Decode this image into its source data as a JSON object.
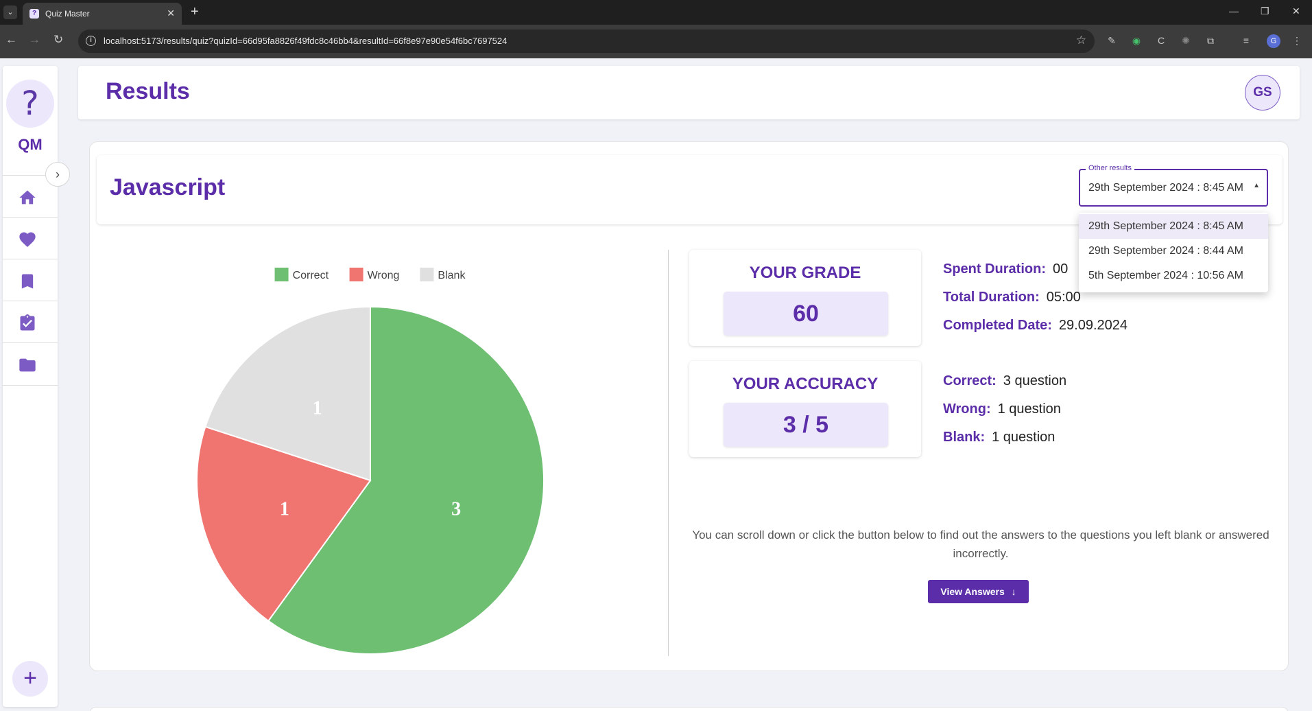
{
  "browser": {
    "tab_title": "Quiz Master",
    "url": "localhost:5173/results/quiz?quizId=66d95fa8826f49fdc8c46bb4&resultId=66f8e97e90e54f6bc7697524",
    "profile_initial": "G"
  },
  "sidebar": {
    "logo_text": "QM",
    "items": [
      {
        "icon": "home-icon"
      },
      {
        "icon": "heart-icon"
      },
      {
        "icon": "bookmark-icon"
      },
      {
        "icon": "clipboard-check-icon"
      },
      {
        "icon": "folder-icon"
      }
    ]
  },
  "header": {
    "title": "Results",
    "avatar_initials": "GS"
  },
  "quiz": {
    "title": "Javascript"
  },
  "other_results": {
    "label": "Other results",
    "selected": "29th September 2024 : 8:45 AM",
    "options": [
      "29th September 2024 : 8:45 AM",
      "29th September 2024 : 8:44 AM",
      "5th September 2024 : 10:56 AM"
    ]
  },
  "grade": {
    "title": "YOUR GRADE",
    "value": "60"
  },
  "accuracy": {
    "title": "YOUR ACCURACY",
    "value": "3 / 5"
  },
  "details": {
    "spent_label": "Spent Duration:",
    "spent_value": "00",
    "total_label": "Total Duration:",
    "total_value": "05:00",
    "completed_label": "Completed Date:",
    "completed_value": "29.09.2024",
    "correct_label": "Correct:",
    "correct_value": "3 question",
    "wrong_label": "Wrong:",
    "wrong_value": "1 question",
    "blank_label": "Blank:",
    "blank_value": "1 question"
  },
  "hint_text": "You can scroll down or click the button below to find out the answers to the questions you left blank or answered incorrectly.",
  "view_answers_label": "View Answers",
  "chart_data": {
    "type": "pie",
    "categories": [
      "Correct",
      "Wrong",
      "Blank"
    ],
    "values": [
      3,
      1,
      1
    ],
    "colors": [
      "#6fbf73",
      "#f07470",
      "#e0e0e0"
    ],
    "legend": "top"
  }
}
